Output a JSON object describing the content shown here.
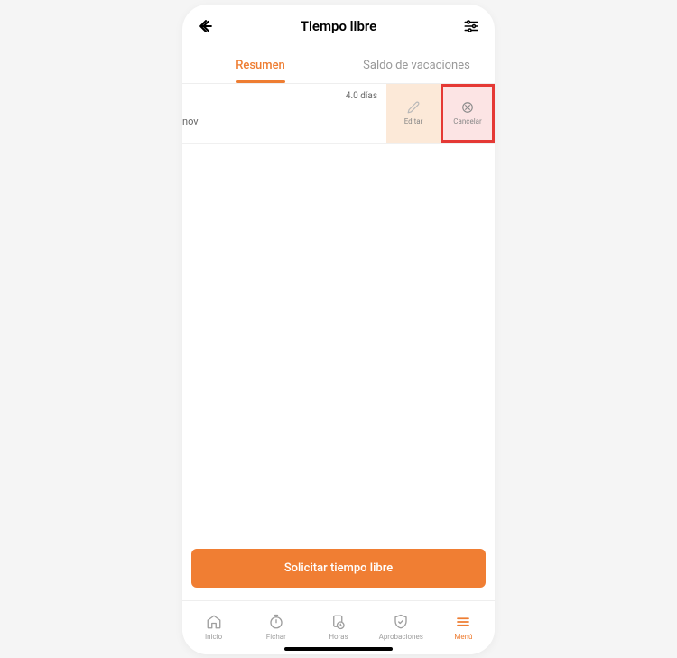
{
  "header": {
    "title": "Tiempo libre"
  },
  "tabs": {
    "summary": "Resumen",
    "balance": "Saldo de vacaciones"
  },
  "entry": {
    "days": "4.0 días",
    "month": "nov",
    "edit": "Editar",
    "cancel": "Cancelar"
  },
  "cta": {
    "request": "Solicitar tiempo libre"
  },
  "nav": {
    "home": "Inicio",
    "clockin": "Fichar",
    "hours": "Horas",
    "approvals": "Aprobaciones",
    "menu": "Menú"
  }
}
